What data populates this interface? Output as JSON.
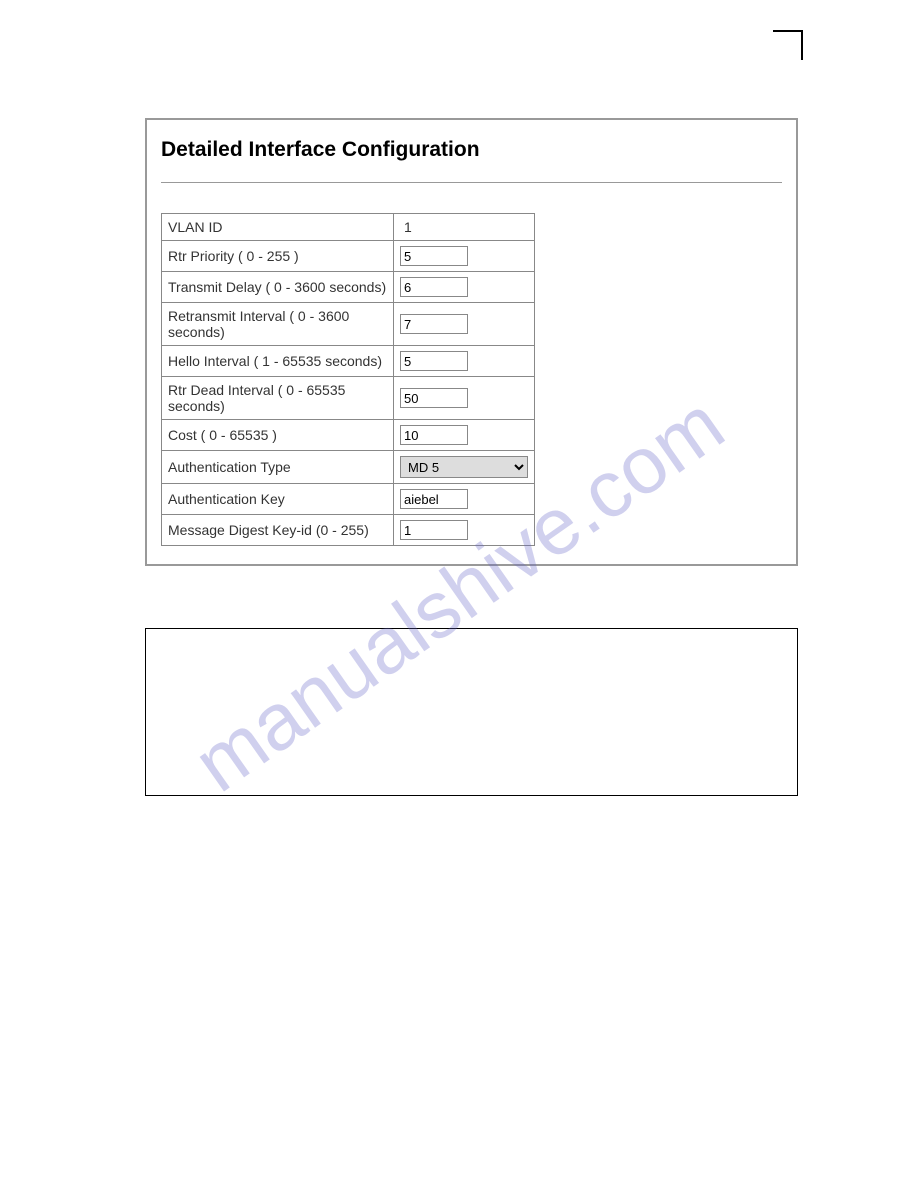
{
  "watermark": "manualshive.com",
  "panel": {
    "title": "Detailed Interface Configuration",
    "rows": [
      {
        "label": "VLAN ID",
        "type": "static",
        "value": "1"
      },
      {
        "label": "Rtr Priority ( 0 - 255 )",
        "type": "input",
        "value": "5"
      },
      {
        "label": "Transmit Delay ( 0 - 3600 seconds)",
        "type": "input",
        "value": "6"
      },
      {
        "label": "Retransmit Interval ( 0 - 3600 seconds)",
        "type": "input",
        "value": "7"
      },
      {
        "label": "Hello Interval ( 1 - 65535 seconds)",
        "type": "input",
        "value": "5"
      },
      {
        "label": "Rtr Dead Interval ( 0 - 65535 seconds)",
        "type": "input",
        "value": "50"
      },
      {
        "label": "Cost ( 0 - 65535 )",
        "type": "input",
        "value": "10"
      },
      {
        "label": "Authentication Type",
        "type": "select",
        "value": "MD 5"
      },
      {
        "label": "Authentication Key",
        "type": "input",
        "value": "aiebel"
      },
      {
        "label": "Message Digest Key-id (0 - 255)",
        "type": "input",
        "value": "1"
      }
    ]
  }
}
